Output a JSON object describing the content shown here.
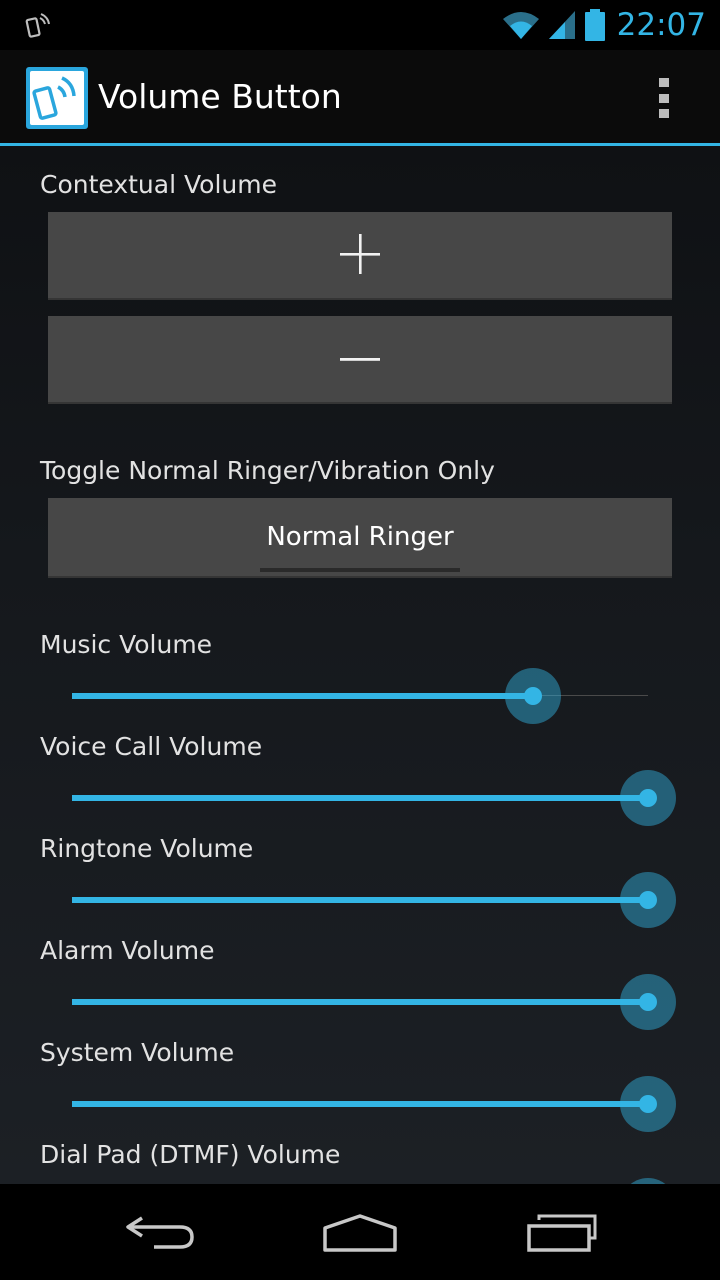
{
  "status_bar": {
    "time": "22:07",
    "left_icon": "phone-rotate-icon",
    "icons": [
      "wifi-icon",
      "signal-icon",
      "battery-icon"
    ],
    "accent": "#33b5e5"
  },
  "action_bar": {
    "title": "Volume Button",
    "app_icon": "volume-button-app-icon",
    "menu_icon": "overflow-menu-icon"
  },
  "contextual": {
    "label": "Contextual Volume",
    "plus_icon": "plus-icon",
    "minus_icon": "minus-icon"
  },
  "toggle": {
    "label": "Toggle Normal Ringer/Vibration Only",
    "value": "Normal Ringer"
  },
  "sliders": [
    {
      "label": "Music Volume",
      "value": 0.8
    },
    {
      "label": "Voice Call Volume",
      "value": 1.0
    },
    {
      "label": "Ringtone Volume",
      "value": 1.0
    },
    {
      "label": "Alarm Volume",
      "value": 1.0
    },
    {
      "label": "System Volume",
      "value": 1.0
    },
    {
      "label": "Dial Pad (DTMF) Volume",
      "value": 1.0
    }
  ],
  "nav_bar": {
    "icons": [
      "back-icon",
      "home-icon",
      "recent-apps-icon"
    ]
  },
  "colors": {
    "accent": "#33b5e5",
    "button_bg": "#474747"
  }
}
